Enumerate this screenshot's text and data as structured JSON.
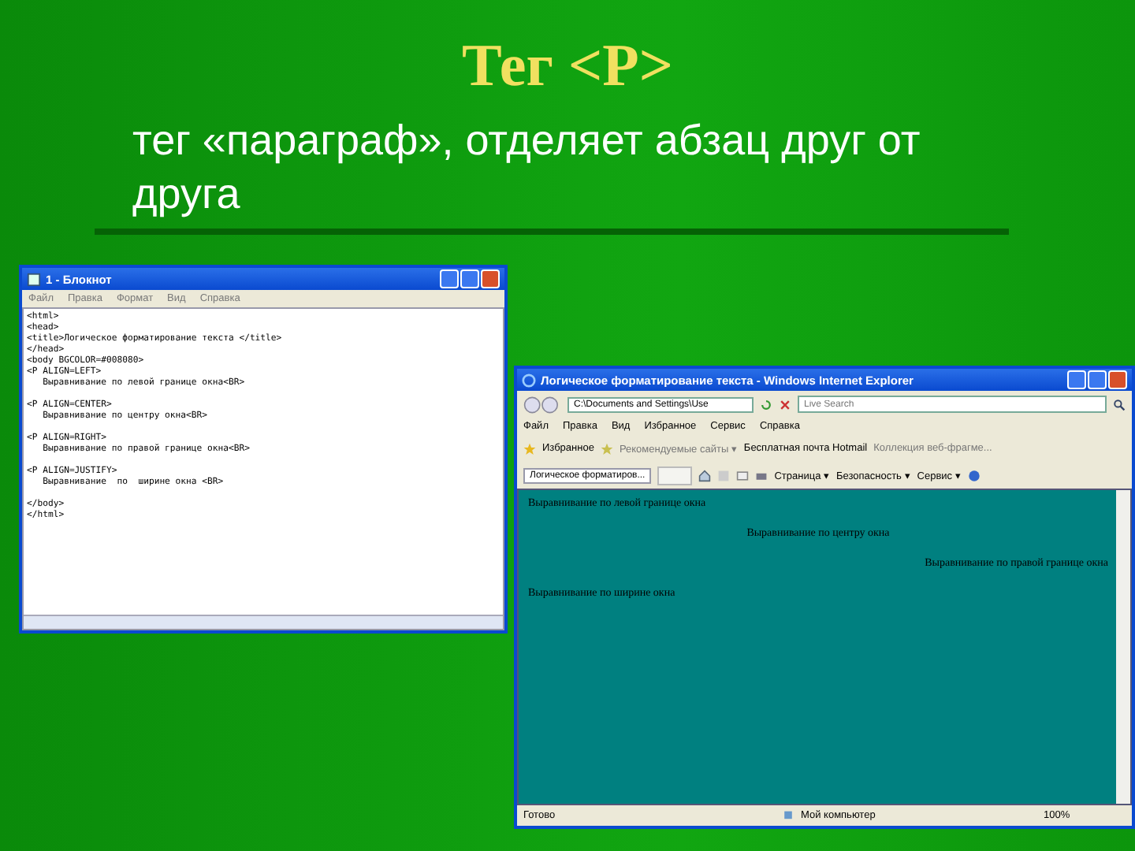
{
  "slide": {
    "title": "Тег <P>",
    "subtitle": "тег «параграф», отделяет абзац друг от друга"
  },
  "notepad": {
    "title": "1 - Блокнот",
    "menu": [
      "Файл",
      "Правка",
      "Формат",
      "Вид",
      "Справка"
    ],
    "blocks": [
      [
        "<html>",
        "<head>",
        "<title>Логическое форматирование текста </title>",
        "</head>",
        "<body BGCOLOR=#008080>",
        "<P ALIGN=LEFT>",
        "   Выравнивание по левой границе окна<BR>"
      ],
      [
        "<P ALIGN=CENTER>",
        "   Выравнивание по центру окна<BR>"
      ],
      [
        "<P ALIGN=RIGHT>",
        "   Выравнивание по правой границе окна<BR>"
      ],
      [
        "<P ALIGN=JUSTIFY>",
        "   Выравнивание  по  ширине окна <BR>"
      ],
      [
        "</body>",
        "</html>"
      ]
    ]
  },
  "browser": {
    "title": "Логическое форматирование текста - Windows Internet Explorer",
    "address": "C:\\Documents and Settings\\Use",
    "search_placeholder": "Live Search",
    "menu": [
      "Файл",
      "Правка",
      "Вид",
      "Избранное",
      "Сервис",
      "Справка"
    ],
    "favorites": {
      "label": "Избранное",
      "links": [
        "Рекомендуемые сайты ▾",
        "Бесплатная почта Hotmail",
        "Коллекция веб-фрагме..."
      ]
    },
    "tab": "Логическое форматиров...",
    "commands": [
      "Страница ▾",
      "Безопасность ▾",
      "Сервис ▾"
    ],
    "paragraphs": [
      {
        "text": "Выравнивание по левой границе окна",
        "kind": "left"
      },
      {
        "text": "Выравнивание по центру окна",
        "kind": "center"
      },
      {
        "text": "Выравнивание по правой границе окна",
        "kind": "right"
      },
      {
        "text": "Выравнивание по ширине окна",
        "kind": "justify"
      }
    ],
    "status": {
      "text": "Готово",
      "zone": "Мой компьютер",
      "zoom": "100%"
    }
  }
}
